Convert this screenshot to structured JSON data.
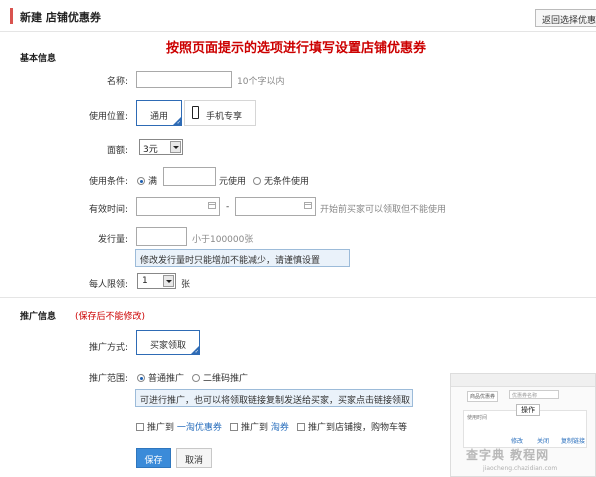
{
  "header": {
    "title": "新建 店铺优惠券",
    "back_button": "返回选择优惠券",
    "instruction": "按照页面提示的选项进行填写设置店铺优惠券",
    "accent": "#d9534f"
  },
  "basic": {
    "section_title": "基本信息",
    "name_label": "名称:",
    "name_value": "",
    "name_hint": "10个字以内",
    "position_label": "使用位置:",
    "position_general": "通用",
    "position_mobile": "手机专享",
    "denom_label": "面额:",
    "denom_value": "3元",
    "condition_label": "使用条件:",
    "condition_full": "满",
    "condition_use": "元使用",
    "condition_none": "无条件使用",
    "valid_label": "有效时间:",
    "valid_dash": "-",
    "valid_hint": "开始前买家可以领取但不能使用",
    "issue_label": "发行量:",
    "issue_hint": "小于100000张",
    "issue_tip": "修改发行量时只能增加不能减少，请谨慎设置",
    "limit_label": "每人限领:",
    "limit_value": "1",
    "limit_unit": "张"
  },
  "promo": {
    "section_title": "推广信息",
    "section_note": "(保存后不能修改)",
    "method_label": "推广方式:",
    "method_value": "买家领取",
    "range_label": "推广范围:",
    "range_general": "普通推广",
    "range_qr": "二维码推广",
    "range_tip": "可进行推广，也可以将领取链接复制发送给买家，买家点击链接领取",
    "push_prefix_1": "推广到",
    "push_link_1": "一淘优惠券",
    "push_prefix_2": "推广到",
    "push_link_2": "淘券",
    "push_3": "推广到店铺搜，购物车等"
  },
  "preview": {
    "tab": "商品优惠券",
    "field_placeholder": "优惠券名称",
    "op_header": "操作",
    "row_label": "使用时间",
    "op_edit": "修改",
    "op_close": "关闭",
    "op_copy": "复制链接"
  },
  "actions": {
    "save": "保存",
    "cancel": "取消"
  },
  "watermark": {
    "line1": "查字典 教程网",
    "line2": "jiaocheng.chazidian.com"
  }
}
